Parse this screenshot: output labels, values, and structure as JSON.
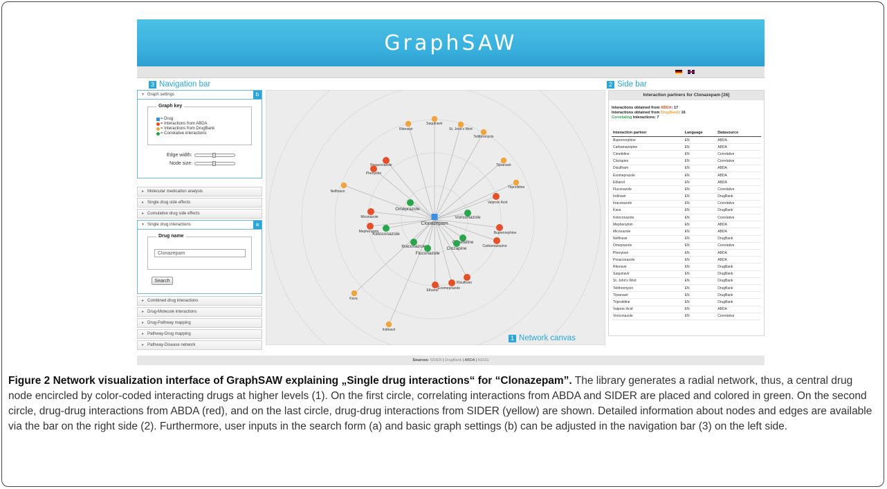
{
  "header": {
    "logo": "GraphSAW"
  },
  "callouts": {
    "nav": {
      "num": "3",
      "label": "Navigation bar"
    },
    "side": {
      "num": "2",
      "label": "Side bar"
    },
    "canvas": {
      "num": "1",
      "label": "Network canvas"
    },
    "a": "a",
    "b": "b"
  },
  "graph_settings": {
    "title": "Graph settings",
    "key_title": "Graph key",
    "key_items": [
      {
        "label": "= Drug",
        "color": "#3a8fe0",
        "shape": "square"
      },
      {
        "label": "= Interactions from ABDA",
        "color": "#e4502a",
        "shape": "circle"
      },
      {
        "label": "= Interactions from DrugBank",
        "color": "#efa43c",
        "shape": "circle"
      },
      {
        "label": "= Correlative interactions",
        "color": "#2aa64a",
        "shape": "circle"
      }
    ],
    "edge_width_label": "Edge width:",
    "node_size_label": "Node size:"
  },
  "nav_sections_top": [
    "Molecular medication analysis",
    "Single drug side effects",
    "Cumulative drug side effects"
  ],
  "single_drug": {
    "title": "Single drug interactions",
    "legend": "Drug name",
    "input_value": "Clonazepam",
    "search_label": "Search"
  },
  "nav_sections_bottom": [
    "Combined drug interactions",
    "Drug-Molecule interactions",
    "Drug-Pathway mapping",
    "Pathway-Drug mapping",
    "Pathway-Disease network"
  ],
  "side_bar": {
    "title": "Interaction partners for Clonazepam [26]",
    "summary": [
      {
        "pre": "Interactions obtained from ",
        "src": "ABDA",
        "post": ": 17"
      },
      {
        "pre": "Interactions obtained from ",
        "src": "DrugBank",
        "post": ": 16"
      },
      {
        "pre": "",
        "src": "Correlating",
        "post": " interactions: 7"
      }
    ],
    "columns": [
      "Interaction partner",
      "Language",
      "Datasource"
    ],
    "rows": [
      [
        "Buprenorphine",
        "EN",
        "ABDA"
      ],
      [
        "Carbamazepine",
        "EN",
        "ABDA"
      ],
      [
        "Cimetidine",
        "EN",
        "Correlative"
      ],
      [
        "Clozapine",
        "EN",
        "Correlative"
      ],
      [
        "Disulfiram",
        "EN",
        "ABDA"
      ],
      [
        "Esomeprazole",
        "EN",
        "ABDA"
      ],
      [
        "Ethanol",
        "EN",
        "ABDA"
      ],
      [
        "Fluconazole",
        "EN",
        "Correlative"
      ],
      [
        "Indinavir",
        "EN",
        "DrugBank"
      ],
      [
        "Itraconazole",
        "EN",
        "Correlative"
      ],
      [
        "Kava",
        "EN",
        "DrugBank"
      ],
      [
        "Ketoconazole",
        "EN",
        "Correlative"
      ],
      [
        "Mephenytoin",
        "EN",
        "ABDA"
      ],
      [
        "Miconazole",
        "EN",
        "ABDA"
      ],
      [
        "Nelfinavir",
        "EN",
        "DrugBank"
      ],
      [
        "Omeprazole",
        "EN",
        "Correlative"
      ],
      [
        "Phenytoin",
        "EN",
        "ABDA"
      ],
      [
        "Posaconazole",
        "EN",
        "ABDA"
      ],
      [
        "Ritonavir",
        "EN",
        "DrugBank"
      ],
      [
        "Saquinavir",
        "EN",
        "DrugBank"
      ],
      [
        "St. John's Wort",
        "EN",
        "DrugBank"
      ],
      [
        "Telithromycin",
        "EN",
        "DrugBank"
      ],
      [
        "Tipranavir",
        "EN",
        "DrugBank"
      ],
      [
        "Triprolidine",
        "EN",
        "DrugBank"
      ],
      [
        "Valproic Acid",
        "EN",
        "ABDA"
      ],
      [
        "Voriconazole",
        "EN",
        "Correlative"
      ]
    ]
  },
  "network": {
    "center": "Clonazepam",
    "nodes": [
      {
        "label": "Omeprazole",
        "type": "Correlative"
      },
      {
        "label": "Voriconazole",
        "type": "Correlative"
      },
      {
        "label": "Ketoconazole",
        "type": "Correlative"
      },
      {
        "label": "Itraconazole",
        "type": "Correlative"
      },
      {
        "label": "Fluconazole",
        "type": "Correlative"
      },
      {
        "label": "Cimetidine",
        "type": "Correlative"
      },
      {
        "label": "Clozapine",
        "type": "Correlative"
      },
      {
        "label": "Posaconazole",
        "type": "ABDA"
      },
      {
        "label": "Phenytoin",
        "type": "ABDA"
      },
      {
        "label": "Valproic Acid",
        "type": "ABDA"
      },
      {
        "label": "Buprenorphine",
        "type": "ABDA"
      },
      {
        "label": "Carbamazepine",
        "type": "ABDA"
      },
      {
        "label": "Disulfiram",
        "type": "ABDA"
      },
      {
        "label": "Esomeprazole",
        "type": "ABDA"
      },
      {
        "label": "Ethanol",
        "type": "ABDA"
      },
      {
        "label": "Miconazole",
        "type": "ABDA"
      },
      {
        "label": "Mephenytoin",
        "type": "ABDA"
      },
      {
        "label": "Ritonavir",
        "type": "DrugBank"
      },
      {
        "label": "Saquinavir",
        "type": "DrugBank"
      },
      {
        "label": "St. John's Wort",
        "type": "DrugBank"
      },
      {
        "label": "Telithromycin",
        "type": "DrugBank"
      },
      {
        "label": "Tipranavir",
        "type": "DrugBank"
      },
      {
        "label": "Triprolidine",
        "type": "DrugBank"
      },
      {
        "label": "Nelfinavir",
        "type": "DrugBank"
      },
      {
        "label": "Kava",
        "type": "DrugBank"
      },
      {
        "label": "Indinavir",
        "type": "DrugBank"
      }
    ]
  },
  "sources": {
    "prefix": "Sources: ",
    "items": [
      "SIDER",
      "DrugBank",
      "ABDA",
      "KEGG"
    ]
  },
  "colors": {
    "ABDA": "#e4502a",
    "DrugBank": "#efa43c",
    "Correlative": "#2aa64a",
    "Drug": "#3a8fe0",
    "accent": "#2aa6d8"
  },
  "caption": {
    "title": "Figure 2 Network visualization interface of GraphSAW explaining „Single drug interactions“ for “Clonazepam”.",
    "text": " The library generates a radial network, thus, a central drug node encircled by color-coded interacting drugs at higher levels (1). On the first circle, correlating interactions from ABDA and SIDER are placed and colored in green. On the second circle, drug-drug interactions from ABDA (red), and on the last circle, drug-drug interactions from SIDER (yellow) are shown. Detailed information about nodes and edges are available via the bar on the right side (2). Furthermore, user inputs in the search form (a) and basic graph settings (b) can be adjusted in the navigation bar (3) on the left side."
  }
}
